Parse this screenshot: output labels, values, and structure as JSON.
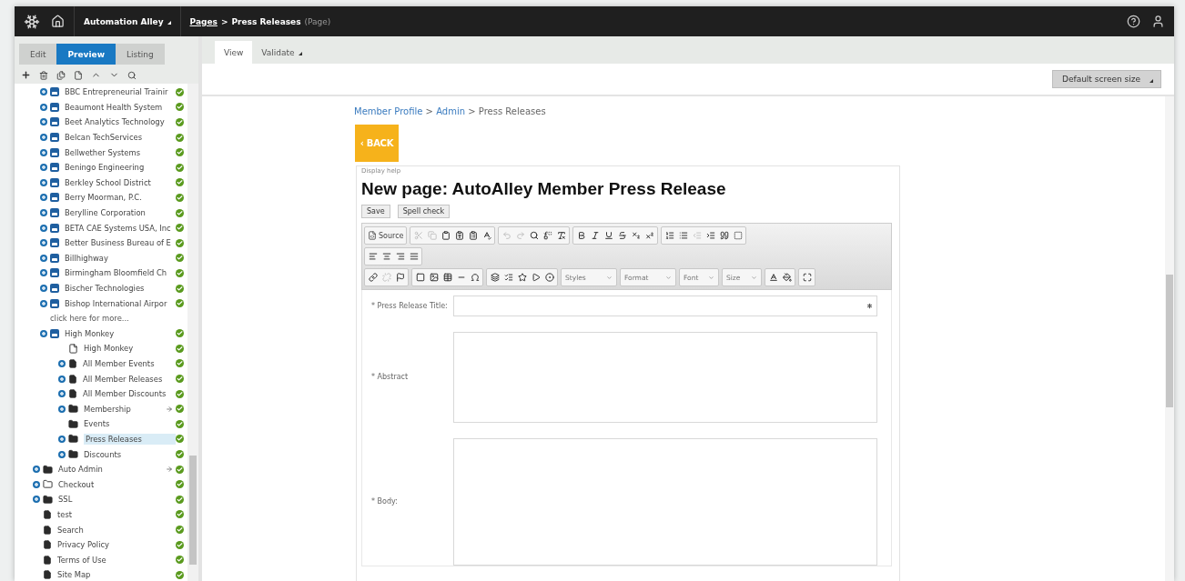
{
  "header": {
    "site": "Automation Alley",
    "crumbs": [
      {
        "text": "Pages",
        "kind": "link"
      },
      {
        "text": "Press Releases",
        "kind": "current"
      }
    ],
    "separator": ">",
    "page_type": "(Page)"
  },
  "left_tabs": [
    {
      "label": "Edit",
      "selected": false
    },
    {
      "label": "Preview",
      "selected": true
    },
    {
      "label": "Listing",
      "selected": false
    }
  ],
  "tree": {
    "nested_items": [
      {
        "label": "BBC Entrepreneurial Trainir",
        "kind": "site",
        "expander": true,
        "published": true,
        "arrow": false,
        "selected": false
      },
      {
        "label": "Beaumont Health System",
        "kind": "site",
        "expander": true,
        "published": true,
        "arrow": false,
        "selected": false
      },
      {
        "label": "Beet Analytics Technology",
        "kind": "site",
        "expander": true,
        "published": true,
        "arrow": false,
        "selected": false
      },
      {
        "label": "Belcan TechServices",
        "kind": "site",
        "expander": true,
        "published": true,
        "arrow": false,
        "selected": false
      },
      {
        "label": "Bellwether Systems",
        "kind": "site",
        "expander": true,
        "published": true,
        "arrow": false,
        "selected": false
      },
      {
        "label": "Beningo Engineering",
        "kind": "site",
        "expander": true,
        "published": true,
        "arrow": false,
        "selected": false
      },
      {
        "label": "Berkley School District",
        "kind": "site",
        "expander": true,
        "published": true,
        "arrow": false,
        "selected": false
      },
      {
        "label": "Berry Moorman, P.C.",
        "kind": "site",
        "expander": true,
        "published": true,
        "arrow": false,
        "selected": false
      },
      {
        "label": "Berylline Corporation",
        "kind": "site",
        "expander": true,
        "published": true,
        "arrow": false,
        "selected": false
      },
      {
        "label": "BETA CAE Systems USA, Inc",
        "kind": "site",
        "expander": true,
        "published": true,
        "arrow": false,
        "selected": false
      },
      {
        "label": "Better Business Bureau of E",
        "kind": "site",
        "expander": true,
        "published": true,
        "arrow": false,
        "selected": false
      },
      {
        "label": "Billhighway",
        "kind": "site",
        "expander": true,
        "published": true,
        "arrow": false,
        "selected": false
      },
      {
        "label": "Birmingham Bloomfield Ch",
        "kind": "site",
        "expander": true,
        "published": true,
        "arrow": false,
        "selected": false
      },
      {
        "label": "Bischer Technologies",
        "kind": "site",
        "expander": true,
        "published": true,
        "arrow": false,
        "selected": false
      },
      {
        "label": "Bishop International Airpor",
        "kind": "site",
        "expander": true,
        "published": true,
        "arrow": false,
        "selected": false
      },
      {
        "label": "click here for more...",
        "kind": "more",
        "expander": false,
        "published": false,
        "arrow": false,
        "selected": false
      },
      {
        "label": "High Monkey",
        "kind": "site",
        "expander": true,
        "published": true,
        "arrow": false,
        "selected": false,
        "children": [
          {
            "label": "High Monkey",
            "kind": "blank",
            "expander": false,
            "published": true,
            "arrow": false,
            "selected": false
          },
          {
            "label": "All Member Events",
            "kind": "document",
            "expander": true,
            "published": true,
            "arrow": false,
            "selected": false
          },
          {
            "label": "All Member Releases",
            "kind": "document",
            "expander": true,
            "published": true,
            "arrow": false,
            "selected": false
          },
          {
            "label": "All Member Discounts",
            "kind": "document",
            "expander": true,
            "published": true,
            "arrow": false,
            "selected": false
          },
          {
            "label": "Membership",
            "kind": "folder",
            "expander": true,
            "published": true,
            "arrow": true,
            "selected": false
          },
          {
            "label": "Events",
            "kind": "folder",
            "expander": false,
            "published": true,
            "arrow": false,
            "selected": false
          },
          {
            "label": "Press Releases",
            "kind": "folder",
            "expander": true,
            "published": true,
            "arrow": false,
            "selected": true
          },
          {
            "label": "Discounts",
            "kind": "folder",
            "expander": true,
            "published": true,
            "arrow": false,
            "selected": false
          }
        ]
      }
    ],
    "root_items": [
      {
        "label": "Auto Admin",
        "kind": "folder",
        "expander": true,
        "published": true,
        "arrow": true,
        "selected": false
      },
      {
        "label": "Checkout",
        "kind": "folder_outline",
        "expander": true,
        "published": true,
        "arrow": false,
        "selected": false
      },
      {
        "label": "SSL",
        "kind": "folder",
        "expander": true,
        "published": true,
        "arrow": false,
        "selected": false
      },
      {
        "label": "test",
        "kind": "document",
        "expander": false,
        "published": true,
        "arrow": false,
        "selected": false
      },
      {
        "label": "Search",
        "kind": "document",
        "expander": false,
        "published": true,
        "arrow": false,
        "selected": false
      },
      {
        "label": "Privacy Policy",
        "kind": "document",
        "expander": false,
        "published": true,
        "arrow": false,
        "selected": false
      },
      {
        "label": "Terms of Use",
        "kind": "document",
        "expander": false,
        "published": true,
        "arrow": false,
        "selected": false
      },
      {
        "label": "Site Map",
        "kind": "document",
        "expander": false,
        "published": true,
        "arrow": false,
        "selected": false
      }
    ]
  },
  "view_tabs": [
    {
      "label": "View",
      "selected": true,
      "dropdown": false
    },
    {
      "label": "Validate",
      "selected": false,
      "dropdown": true
    }
  ],
  "screen_size": "Default screen size",
  "content": {
    "crumbs": [
      {
        "text": "Member Profile",
        "kind": "link"
      },
      {
        "text": "Admin",
        "kind": "link"
      },
      {
        "text": "Press Releases",
        "kind": "current"
      }
    ],
    "separator": ">",
    "back": "‹ BACK",
    "help": "Display help",
    "title": "New page: AutoAlley Member Press Release",
    "buttons": [
      "Save",
      "Spell check"
    ],
    "toolbar_rows": [
      [
        [
          {
            "kind": "source",
            "label": "Source"
          }
        ],
        [
          {
            "kind": "cut",
            "disabled": true
          },
          {
            "kind": "copy",
            "disabled": true
          },
          {
            "kind": "paste",
            "disabled": false
          },
          {
            "kind": "paste_text",
            "disabled": false
          },
          {
            "kind": "paste_word",
            "disabled": false
          },
          {
            "kind": "spell",
            "disabled": false
          }
        ],
        [
          {
            "kind": "undo",
            "disabled": true
          },
          {
            "kind": "redo",
            "disabled": true
          },
          {
            "kind": "find",
            "disabled": false
          },
          {
            "kind": "replace",
            "disabled": false
          },
          {
            "kind": "clear_format",
            "disabled": false
          }
        ],
        [
          {
            "kind": "bold",
            "disabled": false
          },
          {
            "kind": "italic",
            "disabled": false
          },
          {
            "kind": "underline",
            "disabled": false
          },
          {
            "kind": "strike",
            "disabled": false
          },
          {
            "kind": "subscript",
            "disabled": false
          },
          {
            "kind": "superscript",
            "disabled": false
          }
        ],
        [
          {
            "kind": "ordered_list",
            "disabled": false
          },
          {
            "kind": "bullet_list",
            "disabled": false
          },
          {
            "kind": "outdent",
            "disabled": true
          },
          {
            "kind": "indent",
            "disabled": false
          },
          {
            "kind": "quote",
            "disabled": false
          },
          {
            "kind": "div",
            "disabled": false
          }
        ]
      ],
      [
        [
          {
            "kind": "align_left",
            "disabled": false
          },
          {
            "kind": "align_center",
            "disabled": false
          },
          {
            "kind": "align_right",
            "disabled": false
          },
          {
            "kind": "justify",
            "disabled": false
          }
        ]
      ],
      [
        [
          {
            "kind": "link",
            "disabled": false
          },
          {
            "kind": "unlink",
            "disabled": true
          },
          {
            "kind": "anchor",
            "disabled": false
          }
        ],
        [
          {
            "kind": "box",
            "disabled": false
          },
          {
            "kind": "image",
            "disabled": false
          },
          {
            "kind": "table",
            "disabled": false
          },
          {
            "kind": "rule",
            "disabled": false
          },
          {
            "kind": "omega",
            "disabled": false
          }
        ],
        [
          {
            "kind": "layers",
            "disabled": false
          },
          {
            "kind": "checklist",
            "disabled": false
          },
          {
            "kind": "star",
            "disabled": false
          },
          {
            "kind": "video",
            "disabled": false
          },
          {
            "kind": "widget",
            "disabled": false
          }
        ],
        [
          {
            "kind": "combo",
            "label": "Styles"
          }
        ],
        [
          {
            "kind": "combo",
            "label": "Format"
          }
        ],
        [
          {
            "kind": "combo",
            "label": "Font"
          }
        ],
        [
          {
            "kind": "combo",
            "label": "Size"
          }
        ],
        [
          {
            "kind": "text_color",
            "disabled": false
          },
          {
            "kind": "bg_color",
            "disabled": false
          }
        ],
        [
          {
            "kind": "maximize",
            "disabled": false
          }
        ]
      ]
    ],
    "fields": [
      {
        "label": "* Press Release Title:",
        "kind": "line",
        "required_mark": true
      },
      {
        "label": "* Abstract",
        "kind": "area",
        "required_mark": false
      },
      {
        "label": "* Body:",
        "kind": "tall",
        "required_mark": false
      }
    ]
  }
}
